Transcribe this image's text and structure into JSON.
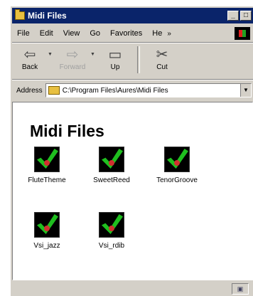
{
  "window": {
    "title": "Midi Files",
    "min_label": "_",
    "max_label": "□",
    "close_label": "×"
  },
  "menu": {
    "items": [
      "File",
      "Edit",
      "View",
      "Go",
      "Favorites",
      "He"
    ],
    "more": "»"
  },
  "toolbar": {
    "back": "Back",
    "forward": "Forward",
    "up": "Up",
    "cut": "Cut"
  },
  "address": {
    "label": "Address",
    "path": "C:\\Program Files\\Aures\\Midi Files"
  },
  "folder": {
    "heading": "Midi Files",
    "files": [
      {
        "name": "FluteTheme"
      },
      {
        "name": "SweetReed"
      },
      {
        "name": "TenorGroove"
      },
      {
        "name": "Vsi_jazz"
      },
      {
        "name": "Vsi_rdib"
      }
    ]
  },
  "colors": {
    "titlebar": "#0a246a",
    "face": "#d4d0c8",
    "check": "#1fbf1f"
  }
}
